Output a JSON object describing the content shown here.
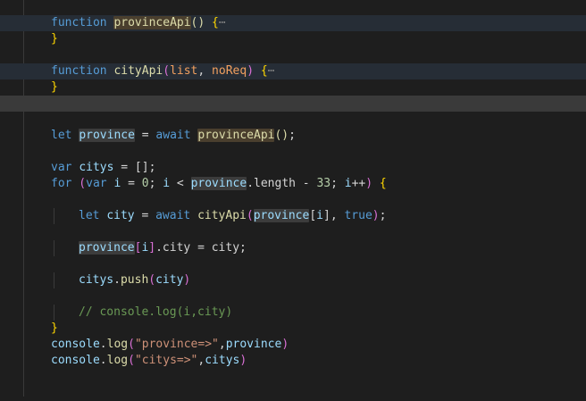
{
  "editor": {
    "lines": {
      "l1": {
        "kw": "function",
        "fn": "provinceApi",
        "args": "()",
        "brace": "{",
        "fold": "⋯"
      },
      "l2": {
        "brace": "}"
      },
      "l4": {
        "kw": "function",
        "fn": "cityApi",
        "p_open": "(",
        "p1": "list",
        "comma": ", ",
        "p2": "noReq",
        "p_close": ")",
        "brace": "{",
        "fold": "⋯"
      },
      "l5": {
        "brace": "}"
      },
      "l8": {
        "kw": "let",
        "var": "province",
        "eq": " = ",
        "await": "await",
        "fn": "provinceApi",
        "args": "()",
        "semi": ";"
      },
      "l10": {
        "kw": "var",
        "var": "citys",
        "rest": " = [];"
      },
      "l11": {
        "kw1": "for",
        "p_open": " (",
        "kw2": "var",
        "i1": "i",
        "eq": " = ",
        "zero": "0",
        "s1": "; ",
        "i2": "i",
        "lt": " < ",
        "prov": "province",
        "len": ".length",
        "minus": " - ",
        "n33": "33",
        "s2": "; ",
        "i3": "i",
        "inc": "++",
        "p_close": ")",
        "brace": " {"
      },
      "l13": {
        "kw": "let",
        "var": "city",
        "eq": " = ",
        "await": "await",
        "fn": "cityApi",
        "p_open": "(",
        "prov": "province",
        "idx_open": "[",
        "i": "i",
        "idx_close": "]",
        "comma": ", ",
        "tr": "true",
        "p_close": ")",
        "semi": ";"
      },
      "l15": {
        "prov": "province",
        "idx_open": "[",
        "i": "i",
        "idx_close": "]",
        "rest": ".city = city;"
      },
      "l17": {
        "obj": "citys",
        "dot": ".",
        "method": "push",
        "p_open": "(",
        "arg": "city",
        "p_close": ")"
      },
      "l19": {
        "comment": "// console.log(i,city)"
      },
      "l20": {
        "brace": "}"
      },
      "l21": {
        "obj": "console",
        "dot": ".",
        "method": "log",
        "p_open": "(",
        "str": "\"province=>\"",
        "comma": ",",
        "arg": "province",
        "p_close": ")"
      },
      "l22": {
        "obj": "console",
        "dot": ".",
        "method": "log",
        "p_open": "(",
        "str": "\"citys=>\"",
        "comma": ",",
        "arg": "citys",
        "p_close": ")"
      }
    }
  }
}
